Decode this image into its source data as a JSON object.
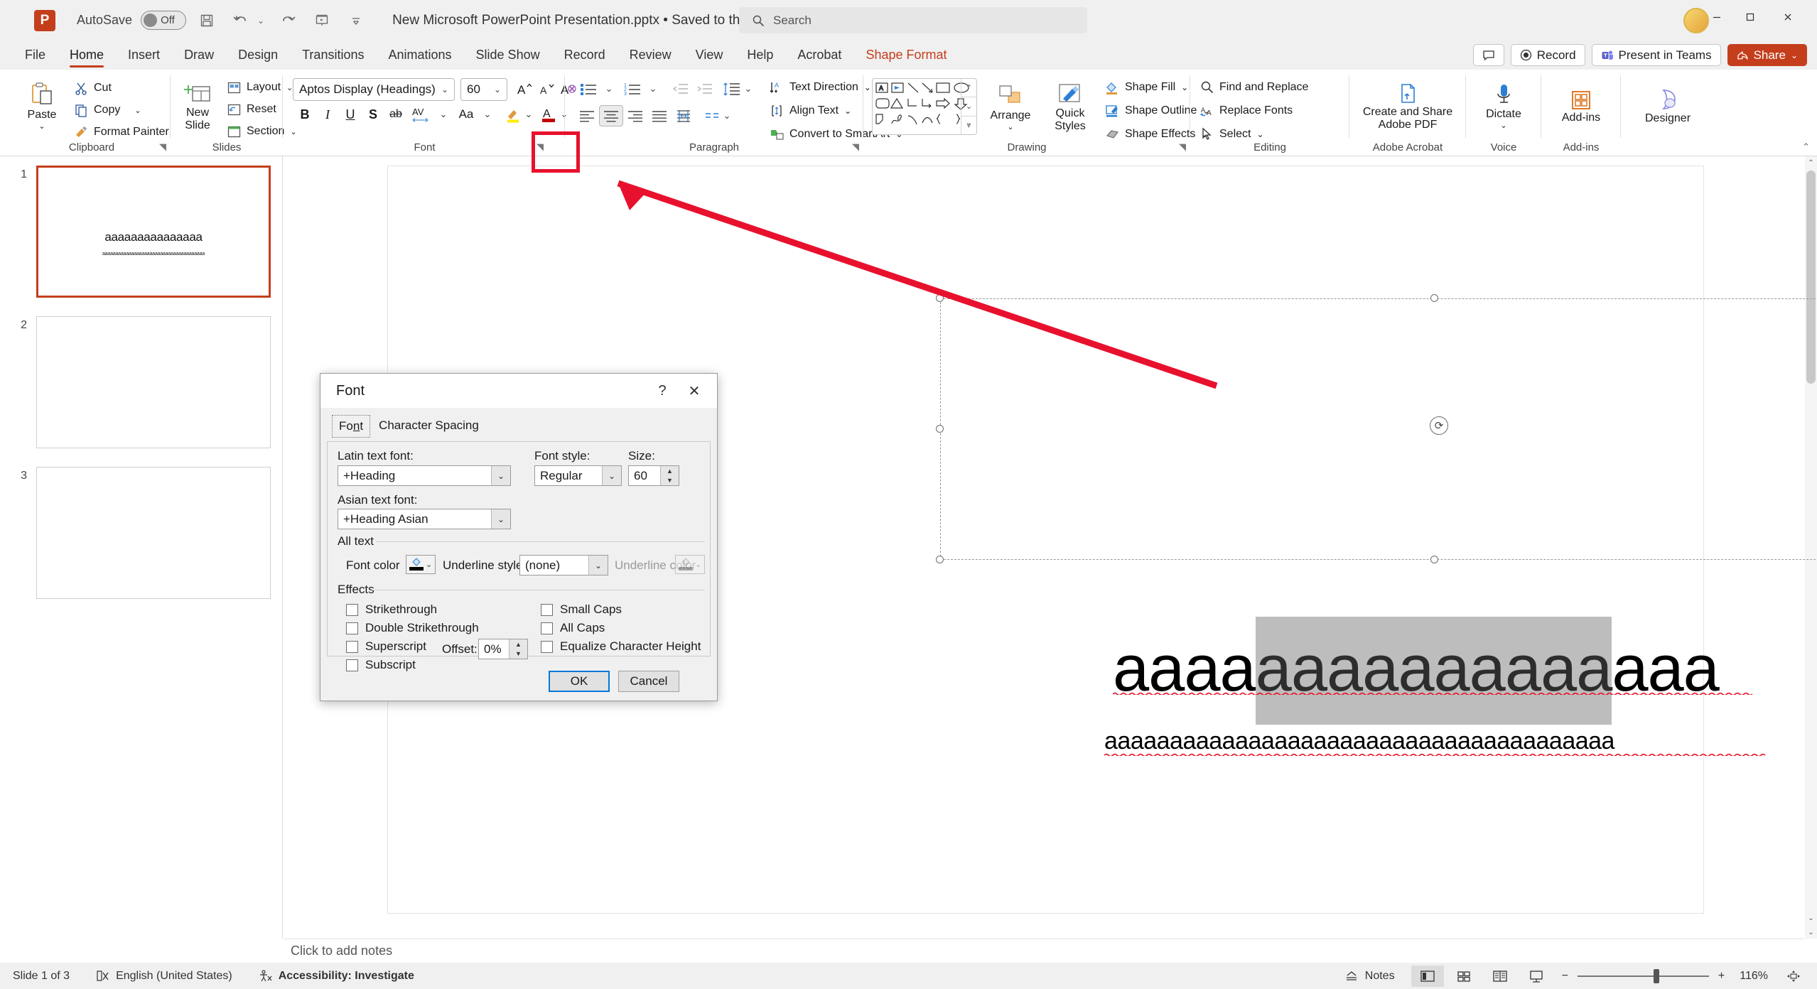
{
  "titlebar": {
    "logo": "P",
    "autosave_label": "AutoSave",
    "autosave_state": "Off",
    "save_icon": "save-icon",
    "undo_icon": "undo-icon",
    "redo_icon": "redo-icon",
    "present_icon": "start-presentation-icon",
    "customize_icon": "customize-quick-access-icon",
    "document_title": "New Microsoft PowerPoint Presentation.pptx • Saved to this PC",
    "search_placeholder": "Search",
    "search_icon": "search-icon",
    "minimize": "minimize-icon",
    "maximize": "maximize-icon",
    "close": "close-icon"
  },
  "tabs": [
    {
      "label": "File",
      "state": "normal"
    },
    {
      "label": "Home",
      "state": "active"
    },
    {
      "label": "Insert",
      "state": "normal"
    },
    {
      "label": "Draw",
      "state": "normal"
    },
    {
      "label": "Design",
      "state": "normal"
    },
    {
      "label": "Transitions",
      "state": "normal"
    },
    {
      "label": "Animations",
      "state": "normal"
    },
    {
      "label": "Slide Show",
      "state": "normal"
    },
    {
      "label": "Record",
      "state": "normal"
    },
    {
      "label": "Review",
      "state": "normal"
    },
    {
      "label": "View",
      "state": "normal"
    },
    {
      "label": "Help",
      "state": "normal"
    },
    {
      "label": "Acrobat",
      "state": "normal"
    },
    {
      "label": "Shape Format",
      "state": "contextual"
    }
  ],
  "topright": {
    "comments": "comments-icon",
    "record": "Record",
    "present_in_teams": "Present in Teams",
    "share": "Share"
  },
  "ribbon": {
    "clipboard": {
      "group_label": "Clipboard",
      "paste": "Paste",
      "cut": "Cut",
      "copy": "Copy",
      "format_painter": "Format Painter"
    },
    "slides": {
      "group_label": "Slides",
      "new_slide": "New\nSlide",
      "new_slide_line1": "New",
      "new_slide_line2": "Slide",
      "layout": "Layout",
      "reset": "Reset",
      "section": "Section"
    },
    "font": {
      "group_label": "Font",
      "font_name": "Aptos Display (Headings)",
      "font_size": "60",
      "grow_font": "A",
      "shrink_font": "A",
      "clear_formatting": "A",
      "bold": "B",
      "italic": "I",
      "underline": "U",
      "shadow": "S",
      "strikethrough": "ab",
      "character_spacing": "AV",
      "change_case": "Aa",
      "text_highlight": "text-highlight-icon",
      "font_color": "A"
    },
    "paragraph": {
      "group_label": "Paragraph",
      "text_direction": "Text Direction",
      "align_text": "Align Text",
      "convert_to_smartart": "Convert to SmartArt"
    },
    "drawing": {
      "group_label": "Drawing",
      "arrange": "Arrange",
      "quick_styles_line1": "Quick",
      "quick_styles_line2": "Styles",
      "shape_fill": "Shape Fill",
      "shape_outline": "Shape Outline",
      "shape_effects": "Shape Effects"
    },
    "editing": {
      "group_label": "Editing",
      "find_and_replace": "Find and Replace",
      "replace_fonts": "Replace Fonts",
      "select": "Select"
    },
    "acrobat": {
      "group_label": "Adobe Acrobat",
      "create_line1": "Create and Share",
      "create_line2": "Adobe PDF"
    },
    "voice": {
      "group_label": "Voice",
      "dictate": "Dictate"
    },
    "addins": {
      "group_label": "Add-ins",
      "addins": "Add-ins"
    },
    "designer": {
      "designer": "Designer"
    }
  },
  "slides_panel": [
    {
      "number": "1",
      "title": "aaaaaaaaaaaaaaa",
      "subtitle": "aaaaaaaaaaaaaaaaaaaaaaaaaaaaaaaaaaaaaaa",
      "selected": true
    },
    {
      "number": "2",
      "title": "",
      "subtitle": "",
      "selected": false
    },
    {
      "number": "3",
      "title": "",
      "subtitle": "",
      "selected": false
    }
  ],
  "canvas": {
    "title_before": "aaaa",
    "title_selected": "aaaaaaaaaa",
    "title_after": "aaa",
    "subtitle": "aaaaaaaaaaaaaaaaaaaaaaaaaaaaaaaaaaaaaaa",
    "rotate_handle": "rotate-handle-icon"
  },
  "notes": {
    "placeholder": "Click to add notes"
  },
  "statusbar": {
    "slide_count": "Slide 1 of 3",
    "language": "English (United States)",
    "accessibility": "Accessibility: Investigate",
    "notes_button": "Notes",
    "zoom_level": "116%",
    "zoom_minus": "−",
    "zoom_plus": "+",
    "fit_slide": "fit-to-window-icon",
    "view_normal": "normal-view-icon",
    "view_sorter": "slide-sorter-icon",
    "view_reading": "reading-view-icon",
    "view_slideshow": "slideshow-view-icon"
  },
  "font_dialog": {
    "title": "Font",
    "help_icon": "?",
    "close_icon": "✕",
    "tabs": [
      {
        "label": "Font",
        "active": true
      },
      {
        "label": "Character Spacing",
        "active": false
      }
    ],
    "latin_text_font_label": "Latin text font:",
    "latin_text_font_value": "+Heading",
    "font_style_label": "Font style:",
    "font_style_value": "Regular",
    "size_label": "Size:",
    "size_value": "60",
    "asian_text_font_label": "Asian text font:",
    "asian_text_font_value": "+Heading Asian",
    "all_text_label": "All text",
    "font_color_label": "Font color",
    "underline_style_label": "Underline style",
    "underline_style_value": "(none)",
    "underline_color_label": "Underline color",
    "effects_label": "Effects",
    "checkboxes": [
      {
        "label": "Strikethrough",
        "checked": false
      },
      {
        "label": "Double Strikethrough",
        "checked": false
      },
      {
        "label": "Superscript",
        "checked": false
      },
      {
        "label": "Subscript",
        "checked": false
      },
      {
        "label": "Small Caps",
        "checked": false
      },
      {
        "label": "All Caps",
        "checked": false
      },
      {
        "label": "Equalize Character Height",
        "checked": false
      }
    ],
    "offset_label": "Offset:",
    "offset_value": "0%",
    "ok_button": "OK",
    "cancel_button": "Cancel"
  },
  "annotation": {
    "highlight_color": "#e8112d",
    "target": "font-dialog-launcher"
  },
  "colors": {
    "accent": "#c43e1c",
    "focus_blue": "#0078d7",
    "ribbon_bg": "#ffffff",
    "chrome_bg": "#f0f0f0"
  }
}
